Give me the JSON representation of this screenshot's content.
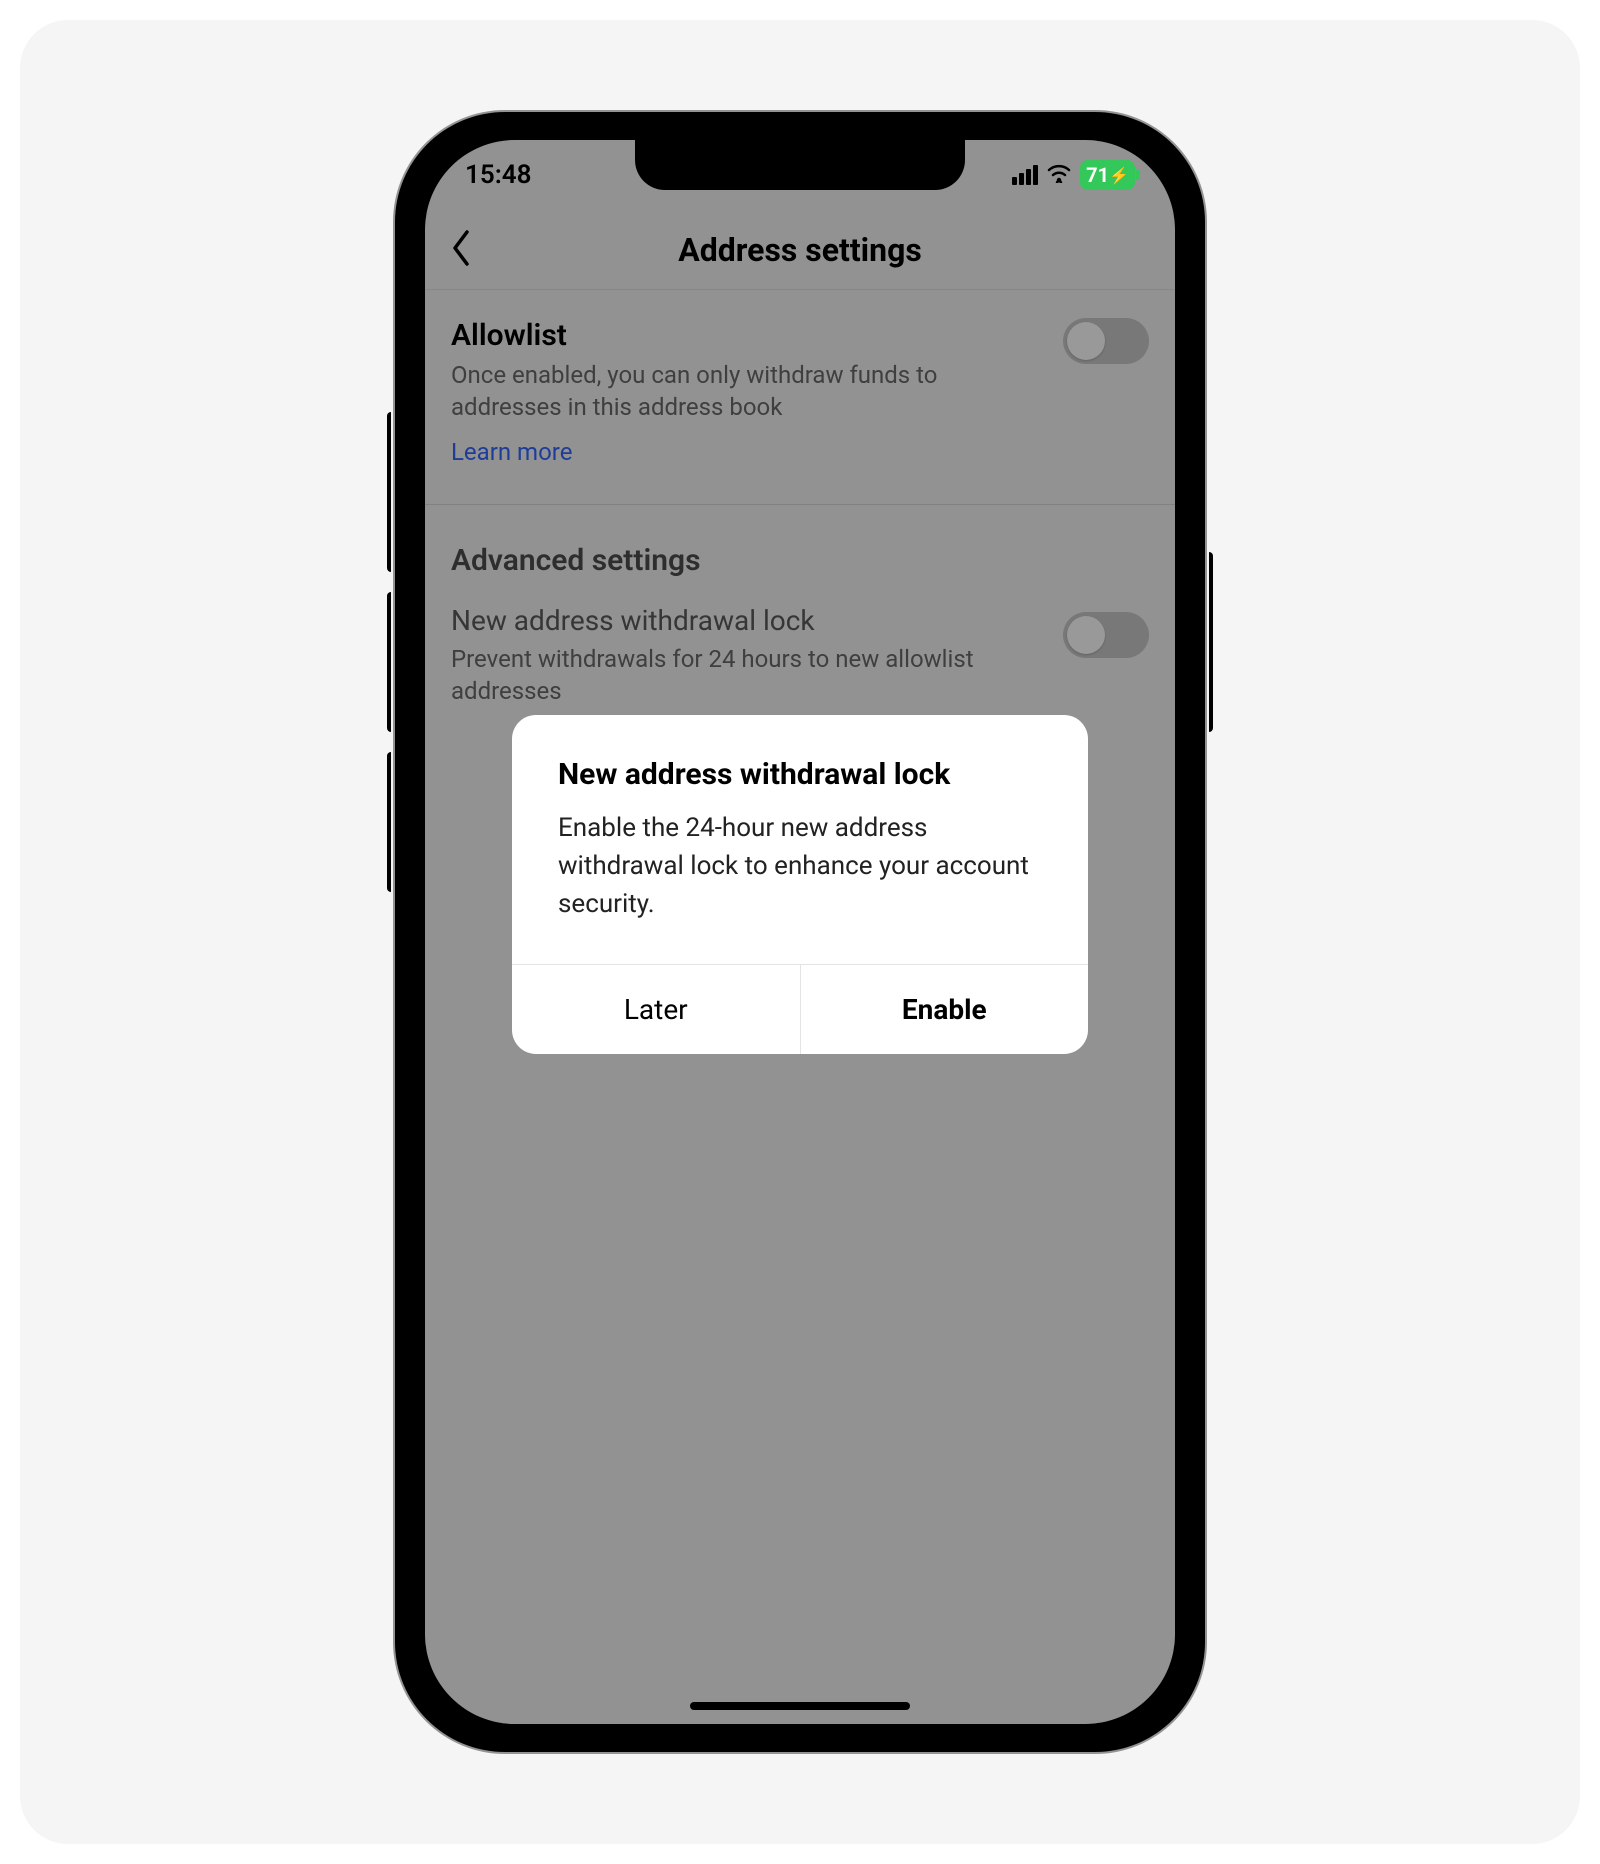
{
  "statusbar": {
    "time": "15:48",
    "battery": "71",
    "bolt": "⚡"
  },
  "nav": {
    "title": "Address settings"
  },
  "allowlist": {
    "title": "Allowlist",
    "desc": "Once enabled, you can only withdraw funds to addresses in this address book",
    "learn_more": "Learn more"
  },
  "advanced": {
    "heading": "Advanced settings",
    "lock_title": "New address withdrawal lock",
    "lock_desc": "Prevent withdrawals for 24 hours to new allowlist addresses"
  },
  "dialog": {
    "title": "New address withdrawal lock",
    "text": "Enable the 24-hour new address withdrawal lock to enhance your account security.",
    "later": "Later",
    "enable": "Enable"
  }
}
